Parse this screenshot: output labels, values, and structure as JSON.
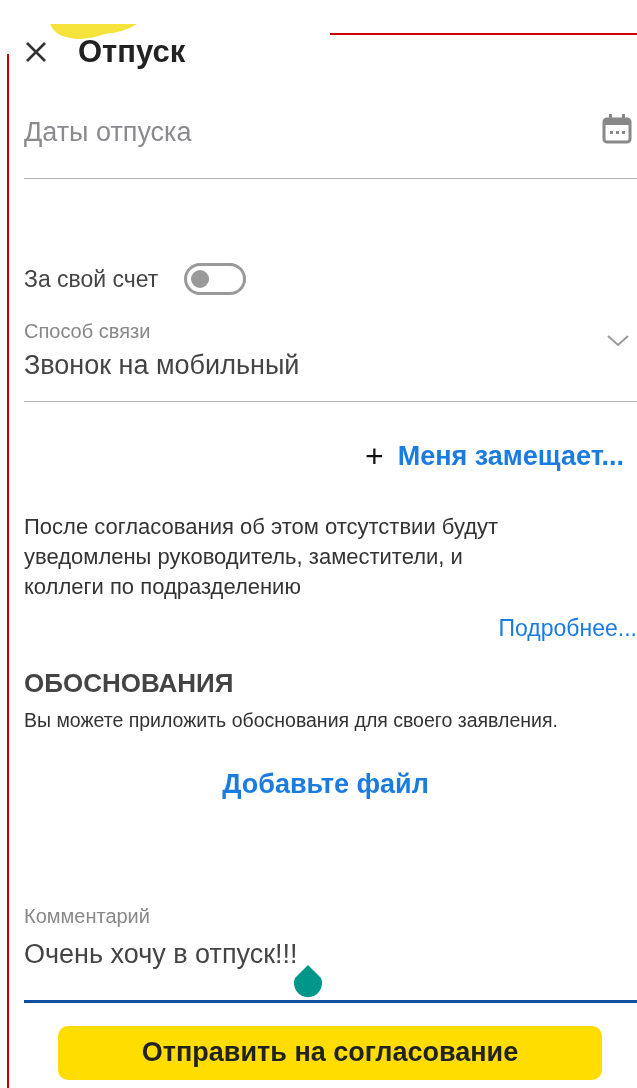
{
  "header": {
    "title": "Отпуск"
  },
  "dates_field": {
    "placeholder": "Даты отпуска"
  },
  "own_expense": {
    "label": "За свой счет",
    "on": false
  },
  "contact_method": {
    "label": "Способ связи",
    "value": "Звонок на мобильный"
  },
  "substitute_link": {
    "icon": "+",
    "label": "Меня замещает..."
  },
  "notice": "После согласования об этом отсутствии будут уведомлены руководитель, заместители, и коллеги по подразделению",
  "more_link": "Подробнее...",
  "justifications": {
    "heading": "ОБОСНОВАНИЯ",
    "description": "Вы можете приложить обоснования для своего заявления.",
    "add_file": "Добавьте файл"
  },
  "comment": {
    "label": "Комментарий",
    "value": "Очень хочу в отпуск!!!",
    "focused": true
  },
  "submit_button": "Отправить на согласование"
}
